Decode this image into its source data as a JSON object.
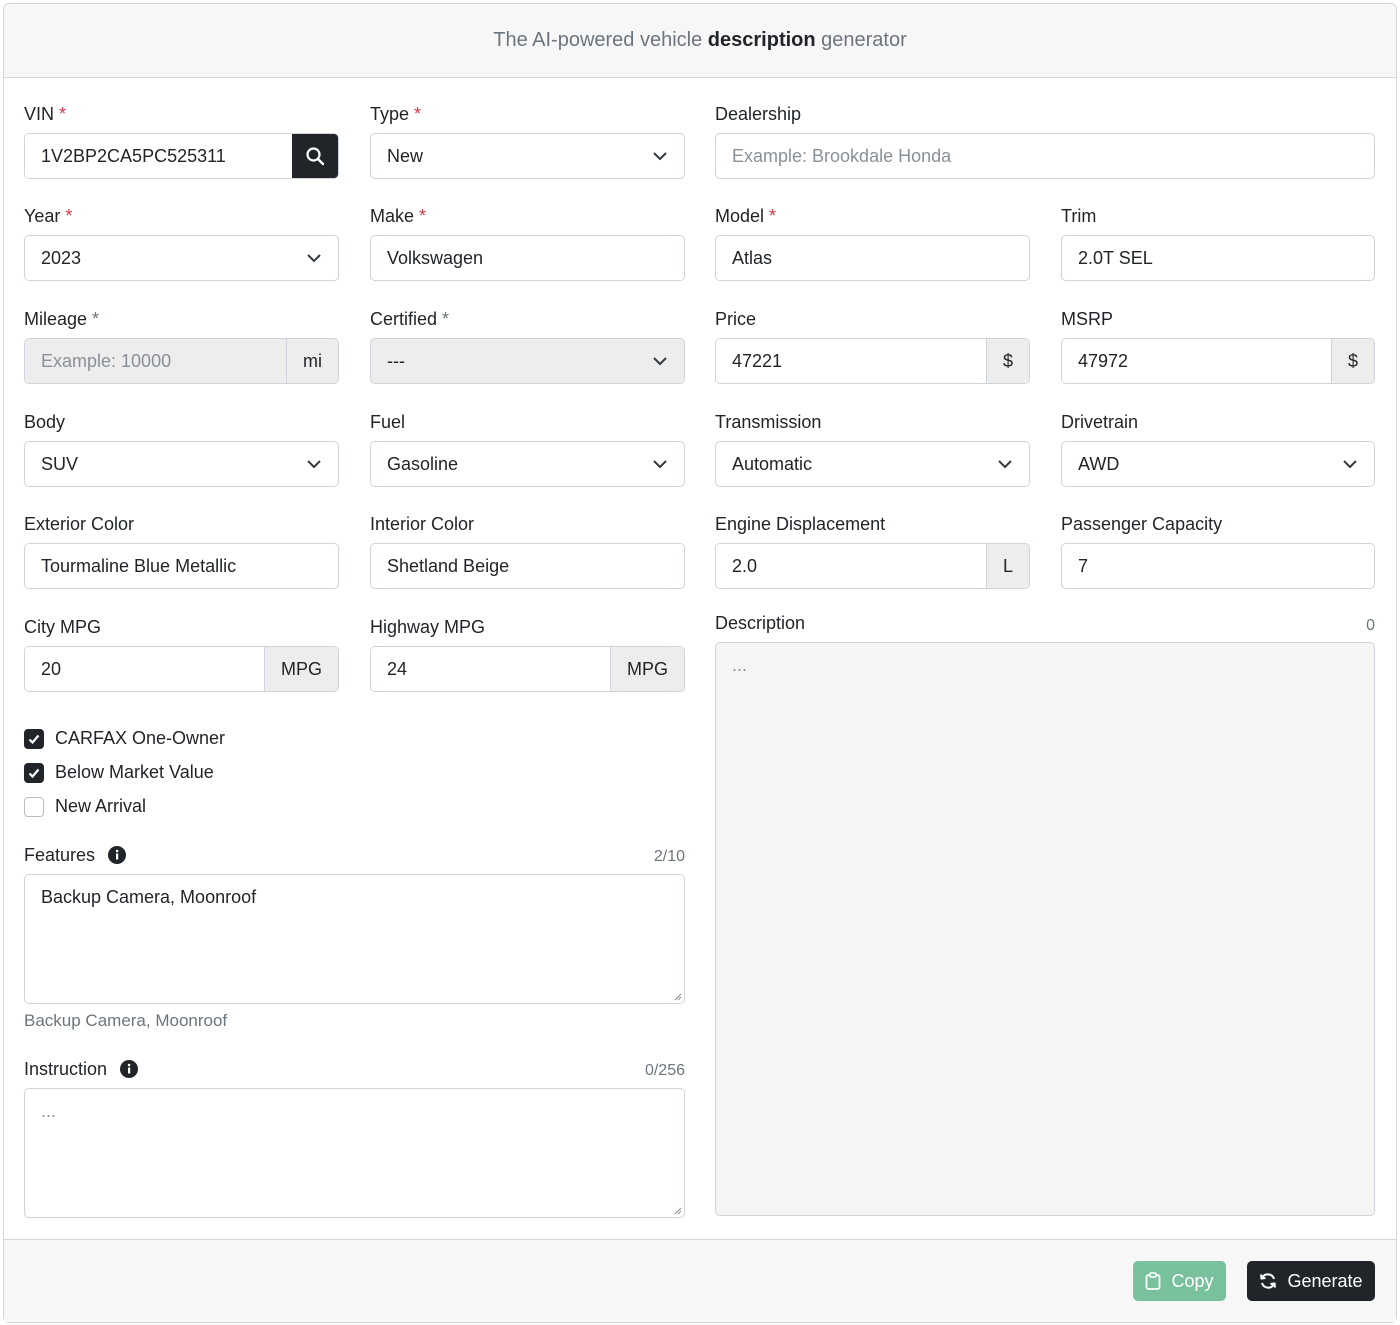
{
  "header": {
    "pre": "The AI-powered vehicle ",
    "bold": "description",
    "post": " generator"
  },
  "vin": {
    "label": "VIN",
    "required": "*",
    "value": "1V2BP2CA5PC525311",
    "button_icon": "search-icon"
  },
  "type": {
    "label": "Type",
    "required": "*",
    "value": "New"
  },
  "dealership": {
    "label": "Dealership",
    "placeholder": "Example: Brookdale Honda"
  },
  "year": {
    "label": "Year",
    "required": "*",
    "value": "2023"
  },
  "make": {
    "label": "Make",
    "required": "*",
    "value": "Volkswagen"
  },
  "model": {
    "label": "Model",
    "required": "*",
    "value": "Atlas"
  },
  "trim": {
    "label": "Trim",
    "value": "2.0T SEL"
  },
  "mileage": {
    "label": "Mileage",
    "required": "*",
    "placeholder": "Example: 10000",
    "unit": "mi"
  },
  "certified": {
    "label": "Certified",
    "required": "*",
    "value": "---"
  },
  "price": {
    "label": "Price",
    "value": "47221",
    "unit": "$"
  },
  "msrp": {
    "label": "MSRP",
    "value": "47972",
    "unit": "$"
  },
  "body": {
    "label": "Body",
    "value": "SUV"
  },
  "fuel": {
    "label": "Fuel",
    "value": "Gasoline"
  },
  "transmission": {
    "label": "Transmission",
    "value": "Automatic"
  },
  "drivetrain": {
    "label": "Drivetrain",
    "value": "AWD"
  },
  "exterior_color": {
    "label": "Exterior Color",
    "value": "Tourmaline Blue Metallic"
  },
  "interior_color": {
    "label": "Interior Color",
    "value": "Shetland Beige"
  },
  "engine_displacement": {
    "label": "Engine Displacement",
    "value": "2.0",
    "unit": "L"
  },
  "passenger_capacity": {
    "label": "Passenger Capacity",
    "value": "7"
  },
  "city_mpg": {
    "label": "City MPG",
    "value": "20",
    "unit": "MPG"
  },
  "highway_mpg": {
    "label": "Highway MPG",
    "value": "24",
    "unit": "MPG"
  },
  "description": {
    "label": "Description",
    "count": "0",
    "placeholder": "..."
  },
  "checkboxes": [
    {
      "label": "CARFAX One-Owner",
      "checked": true
    },
    {
      "label": "Below Market Value",
      "checked": true
    },
    {
      "label": "New Arrival",
      "checked": false
    }
  ],
  "features": {
    "label": "Features",
    "count": "2/10",
    "value": "Backup Camera, Moonroof",
    "help": "Backup Camera, Moonroof"
  },
  "instruction": {
    "label": "Instruction",
    "count": "0/256",
    "placeholder": "..."
  },
  "footer": {
    "copy_label": "Copy",
    "generate_label": "Generate"
  },
  "colors": {
    "dark": "#212529",
    "copy_button": "#79c09d",
    "required": "#dc3545"
  }
}
